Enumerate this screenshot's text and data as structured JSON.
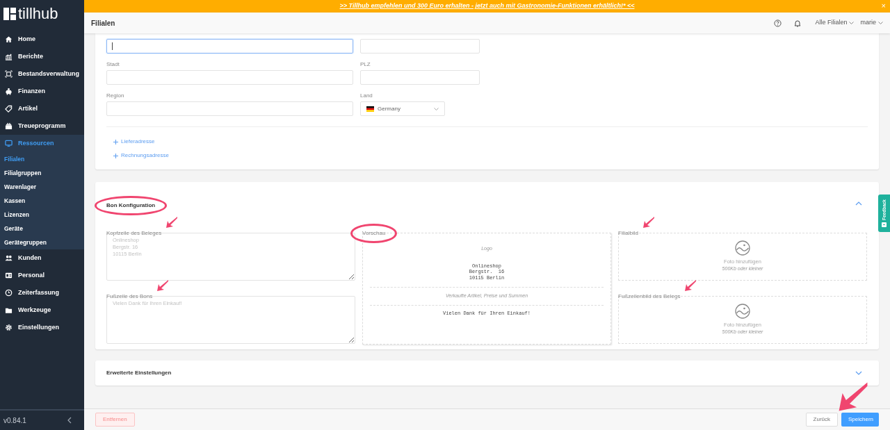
{
  "banner": {
    "text": ">> Tillhub empfehlen und 300 Euro erhalten - jetzt auch mit Gastronomie-Funktionen erhältlich!* <<",
    "close": "×"
  },
  "logo": "tillhub",
  "sidebar": {
    "items": [
      {
        "label": "Home",
        "selected": false
      },
      {
        "label": "Berichte",
        "selected": false
      },
      {
        "label": "Bestandsverwaltung",
        "selected": false
      },
      {
        "label": "Finanzen",
        "selected": false
      },
      {
        "label": "Artikel",
        "selected": false
      },
      {
        "label": "Treueprogramm",
        "selected": false
      },
      {
        "label": "Ressourcen",
        "selected": true,
        "children": [
          {
            "label": "Filialen",
            "selected": true
          },
          {
            "label": "Filialgruppen",
            "selected": false
          },
          {
            "label": "Warenlager",
            "selected": false
          },
          {
            "label": "Kassen",
            "selected": false
          },
          {
            "label": "Lizenzen",
            "selected": false
          },
          {
            "label": "Geräte",
            "selected": false
          },
          {
            "label": "Gerätegruppen",
            "selected": false
          }
        ]
      },
      {
        "label": "Kunden",
        "selected": false
      },
      {
        "label": "Personal",
        "selected": false
      },
      {
        "label": "Zeiterfassung",
        "selected": false
      },
      {
        "label": "Werkzeuge",
        "selected": false
      },
      {
        "label": "Einstellungen",
        "selected": false
      }
    ],
    "version": "v0.84.1"
  },
  "header": {
    "title": "Filialen",
    "store_select": "Alle Filialen",
    "user": "marie"
  },
  "address": {
    "fields": [
      {
        "kind": "text",
        "focused": true
      },
      {
        "kind": "text",
        "focused": false
      },
      {
        "kind": "text",
        "label": "Stadt",
        "focused": false
      },
      {
        "kind": "text",
        "label": "PLZ",
        "focused": false
      },
      {
        "kind": "text",
        "label": "Region",
        "focused": false
      },
      {
        "kind": "select",
        "label": "Land",
        "value": "Germany",
        "focused": false
      }
    ],
    "links": [
      "Lieferadresse",
      "Rechnungsadresse"
    ]
  },
  "bon": {
    "title": "Bon Konfiguration",
    "circled": true,
    "expanded": true,
    "header_field": {
      "label": "Kopfzeile des Beleges",
      "placeholder": "Onlineshop\nBergstr. 16\n10115 Berlin",
      "arrow": true
    },
    "footer_field": {
      "label": "Fußzeile des Bons",
      "placeholder": "Vielen Dank für Ihren Einkauf!",
      "arrow": true
    },
    "preview": {
      "label": "Vorschau",
      "circled": true,
      "logo": "Logo",
      "header": "Onlineshop\nBergstr.  16\n10115 Berlin",
      "items": "Verkaufte Artikel, Preise und Summen",
      "footer": "Vielen Dank für Ihren Einkauf!"
    },
    "images": [
      {
        "label": "Filialbild",
        "action": "Foto hinzufügen",
        "hint": "500Kb oder kleiner",
        "arrow": true
      },
      {
        "label": "Fußzeilenbild des Belegs",
        "action": "Foto hinzufügen",
        "hint": "500Kb oder kleiner",
        "arrow": true
      }
    ]
  },
  "advanced": {
    "title": "Erweiterte Einstellungen",
    "expanded": false
  },
  "footer": {
    "delete": "Entfernen",
    "back": "Zurück",
    "save": {
      "label": "Speichern",
      "arrow": true
    }
  },
  "feedback": "Feedback"
}
